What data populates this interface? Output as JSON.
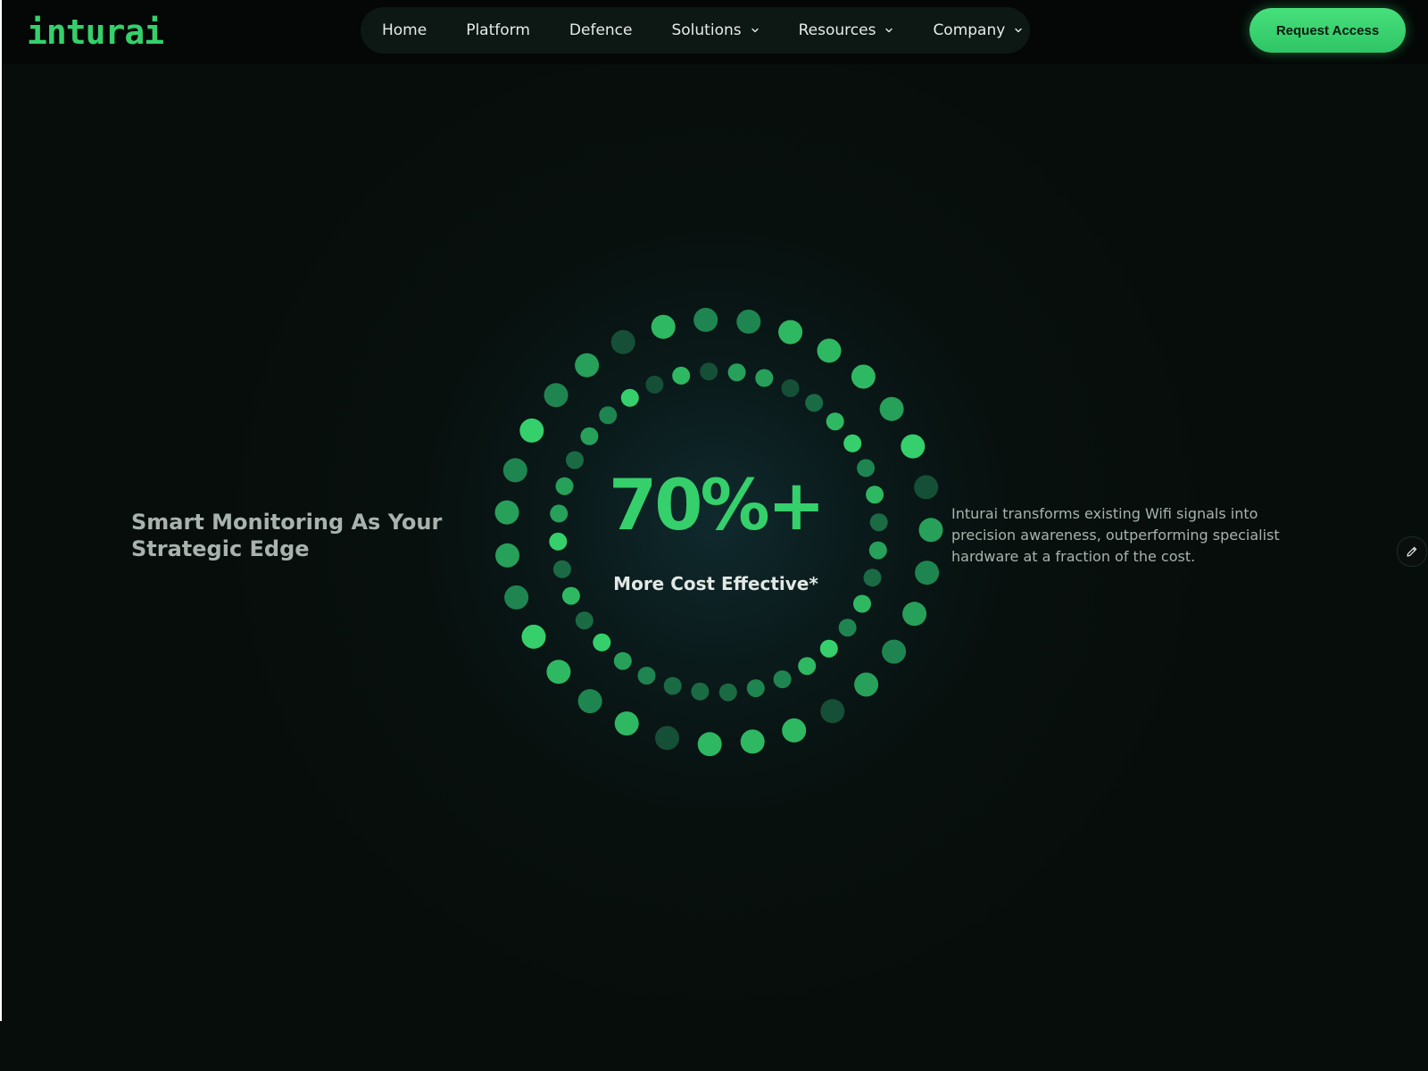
{
  "header": {
    "logo_text": "inturai",
    "nav_items": [
      {
        "label": "Home",
        "has_dropdown": false
      },
      {
        "label": "Platform",
        "has_dropdown": false
      },
      {
        "label": "Defence",
        "has_dropdown": false
      },
      {
        "label": "Solutions",
        "has_dropdown": true
      },
      {
        "label": "Resources",
        "has_dropdown": true
      },
      {
        "label": "Company",
        "has_dropdown": true
      }
    ],
    "cta_label": "Request Access"
  },
  "hero": {
    "headline": "Smart Monitoring As Your Strategic Edge",
    "stat_value": "70%+",
    "stat_label": "More Cost Effective*",
    "description": "Inturai transforms existing Wifi signals into precision awareness, outperforming specialist hardware at a fraction of the cost."
  },
  "icons": {
    "dropdown": "chevron-down-icon",
    "edit": "pencil-icon"
  },
  "colors": {
    "accent": "#35d06b",
    "background": "#070d0b",
    "nav_background": "#0d1713",
    "text_muted": "#a8b3ad",
    "text_light": "#e2e8e5"
  }
}
